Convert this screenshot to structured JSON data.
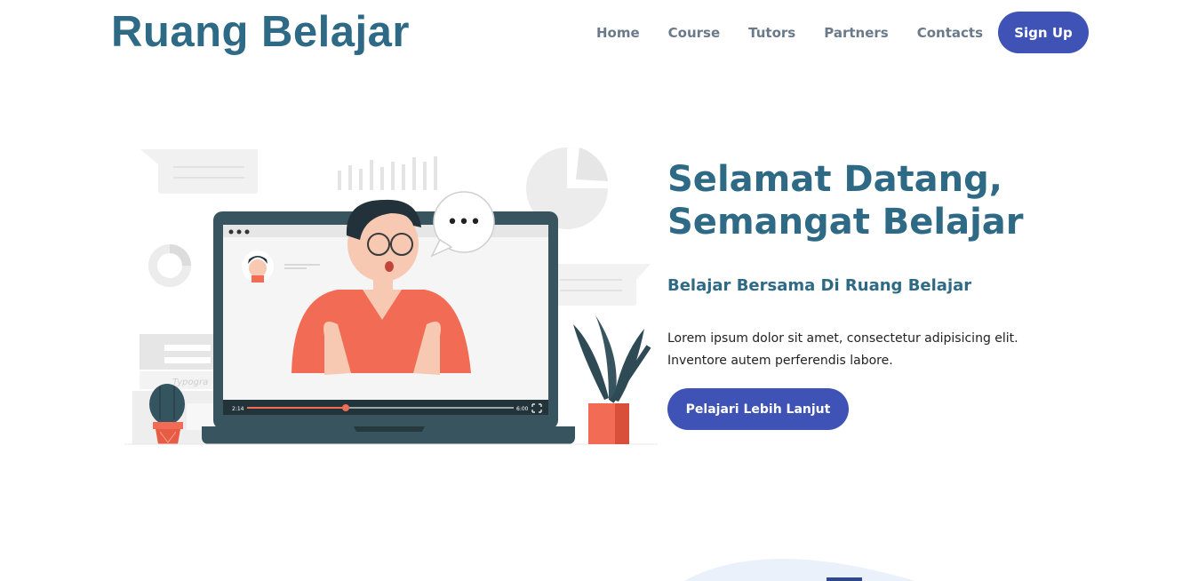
{
  "brand": {
    "logo_text": "Ruang Belajar"
  },
  "nav": {
    "items": [
      {
        "label": "Home"
      },
      {
        "label": "Course"
      },
      {
        "label": "Tutors"
      },
      {
        "label": "Partners"
      },
      {
        "label": "Contacts"
      }
    ],
    "signup_label": "Sign Up"
  },
  "hero": {
    "title_line1": "Selamat Datang,",
    "title_line2": "Semangat Belajar",
    "subtitle": "Belajar Bersama Di Ruang Belajar",
    "description_line1": "Lorem ipsum dolor sit amet, consectetur adipisicing elit.",
    "description_line2": "Inventore autem perferendis labore.",
    "cta_label": "Pelajari Lebih Lanjut"
  },
  "illustration": {
    "video_current_time": "2:14",
    "video_total_time": "6:00",
    "bubble_text": "•••",
    "book_text": "Typogra",
    "video_progress": 0.37
  },
  "colors": {
    "brand": "#2e6a85",
    "button": "#3f52b5",
    "nav_text": "#6b7a8a",
    "accent": "#f26b54"
  }
}
